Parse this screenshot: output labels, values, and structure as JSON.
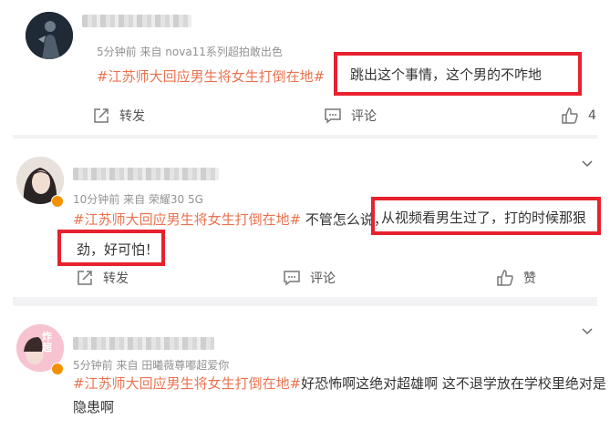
{
  "posts": [
    {
      "meta": "5分钟前  来自 nova11系列超拍敢出色",
      "topic": "#江苏师大回应男生将女生打倒在地#",
      "body_before": "",
      "highlight": "跳出这个事情，这个男的不咋地",
      "body_after": "",
      "actions": {
        "forward": "转发",
        "comment": "评论",
        "like": "4"
      }
    },
    {
      "meta": "10分钟前  来自 荣耀30 5G",
      "topic": "#江苏师大回应男生将女生打倒在地#",
      "body_before": " 不管怎么说，",
      "highlight": "从视频看男生过了，打的时候那狠",
      "highlight2": "劲，好可怕！",
      "actions": {
        "forward": "转发",
        "comment": "评论",
        "like": "赞"
      }
    },
    {
      "meta": "5分钟前  来自 田曦薇尊嘟超爱你",
      "topic": "#江苏师大回应男生将女生打倒在地#",
      "body": "好恐怖啊这绝对超雄啊 这不退学放在学校里绝对是",
      "body2": "隐患啊",
      "avatar_badge": "炸超"
    }
  ]
}
